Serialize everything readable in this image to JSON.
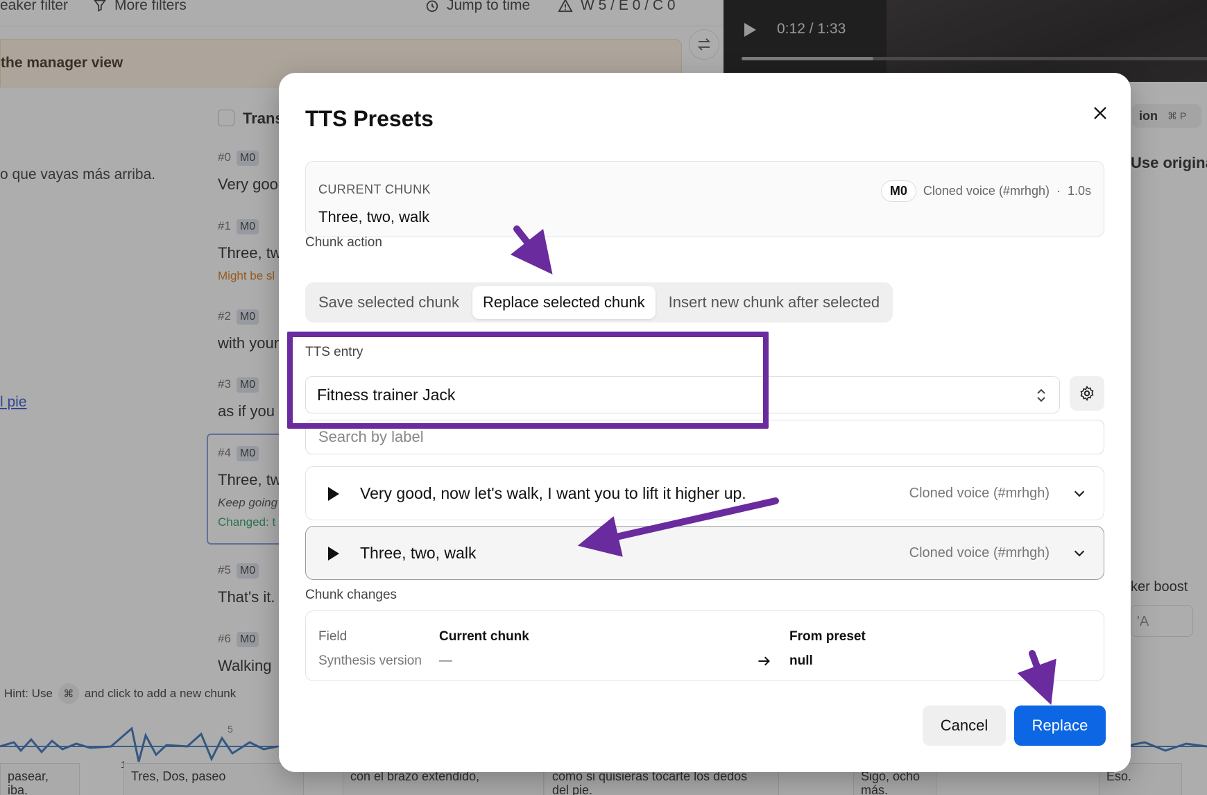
{
  "background": {
    "topbar": {
      "speaker_filter": "eaker filter",
      "more_filters": "More filters",
      "jump_to_time": "Jump to time",
      "warnings": "W 5 / E 0 / C 0"
    },
    "banner_text": "the manager view",
    "video": {
      "time": "0:12 / 1:33",
      "progress": 0.28
    },
    "left_lines": [
      "o que vayas más arriba.",
      "l pie"
    ],
    "transcript_header": "Trans",
    "chunks": [
      {
        "idx": "#0",
        "tag": "M0",
        "text": "Very goo"
      },
      {
        "idx": "#1",
        "tag": "M0",
        "text": "Three, tw",
        "note": "Might be sl"
      },
      {
        "idx": "#2",
        "tag": "M0",
        "text": "with your"
      },
      {
        "idx": "#3",
        "tag": "M0",
        "text": "as if you"
      },
      {
        "idx": "#4",
        "tag": "M0",
        "text": "Three, tw",
        "note": "Keep going",
        "changed": "Changed: t"
      },
      {
        "idx": "#5",
        "tag": "M0",
        "text": "That's it."
      },
      {
        "idx": "#6",
        "tag": "M0",
        "text": "Walking"
      }
    ],
    "right_panel": {
      "shortcut_label": "ion",
      "shortcut_key": "⌘ P",
      "use_original": "Use origina",
      "speaker_boost": "ker boost",
      "speaker_boost_value": "'A"
    },
    "hint": {
      "prefix": "Hint: Use",
      "key": "⌘",
      "suffix": "and click to add a new chunk"
    },
    "timeline_marks": [
      "1",
      "5"
    ],
    "subtitles": [
      "pasear,\niba.",
      "Tres, Dos, paseo",
      "con el brazo extendido,",
      "como si quisieras tocarte los dedos\ndel pie.",
      "Sigo, ocho\nmás.",
      "Eso."
    ]
  },
  "modal": {
    "title": "TTS Presets",
    "current_chunk": {
      "label": "CURRENT CHUNK",
      "text": "Three, two, walk",
      "tag": "M0",
      "voice": "Cloned voice (#mrhgh)",
      "separator": "·",
      "duration": "1.0s"
    },
    "chunk_action": {
      "label": "Chunk action",
      "options": [
        "Save selected chunk",
        "Replace selected chunk",
        "Insert new chunk after selected"
      ],
      "selected": "Replace selected chunk"
    },
    "tts_entry": {
      "label": "TTS entry",
      "value": "Fitness trainer Jack"
    },
    "search": {
      "placeholder": "Search by label",
      "value": ""
    },
    "presets": [
      {
        "text": "Very good, now let's walk, I want you to lift it higher up.",
        "voice": "Cloned voice (#mrhgh)",
        "selected": false
      },
      {
        "text": "Three, two, walk",
        "voice": "Cloned voice (#mrhgh)",
        "selected": true
      }
    ],
    "chunk_changes": {
      "label": "Chunk changes",
      "headers": {
        "field": "Field",
        "current": "Current chunk",
        "preset": "From preset"
      },
      "rows": [
        {
          "field": "Synthesis version",
          "current": "—",
          "arrow": "→",
          "preset": "null"
        }
      ]
    },
    "buttons": {
      "cancel": "Cancel",
      "replace": "Replace"
    }
  },
  "colors": {
    "accent": "#0d66e4",
    "annotation": "#6a2b9f",
    "overlay": "rgba(60,60,60,0.42)"
  },
  "icons": [
    "filter-icon",
    "clock-icon",
    "warning-icon",
    "swap-icon",
    "play-icon",
    "close-icon",
    "gear-icon",
    "chevron-updown-icon",
    "chevron-down-icon",
    "arrow-right-icon"
  ]
}
